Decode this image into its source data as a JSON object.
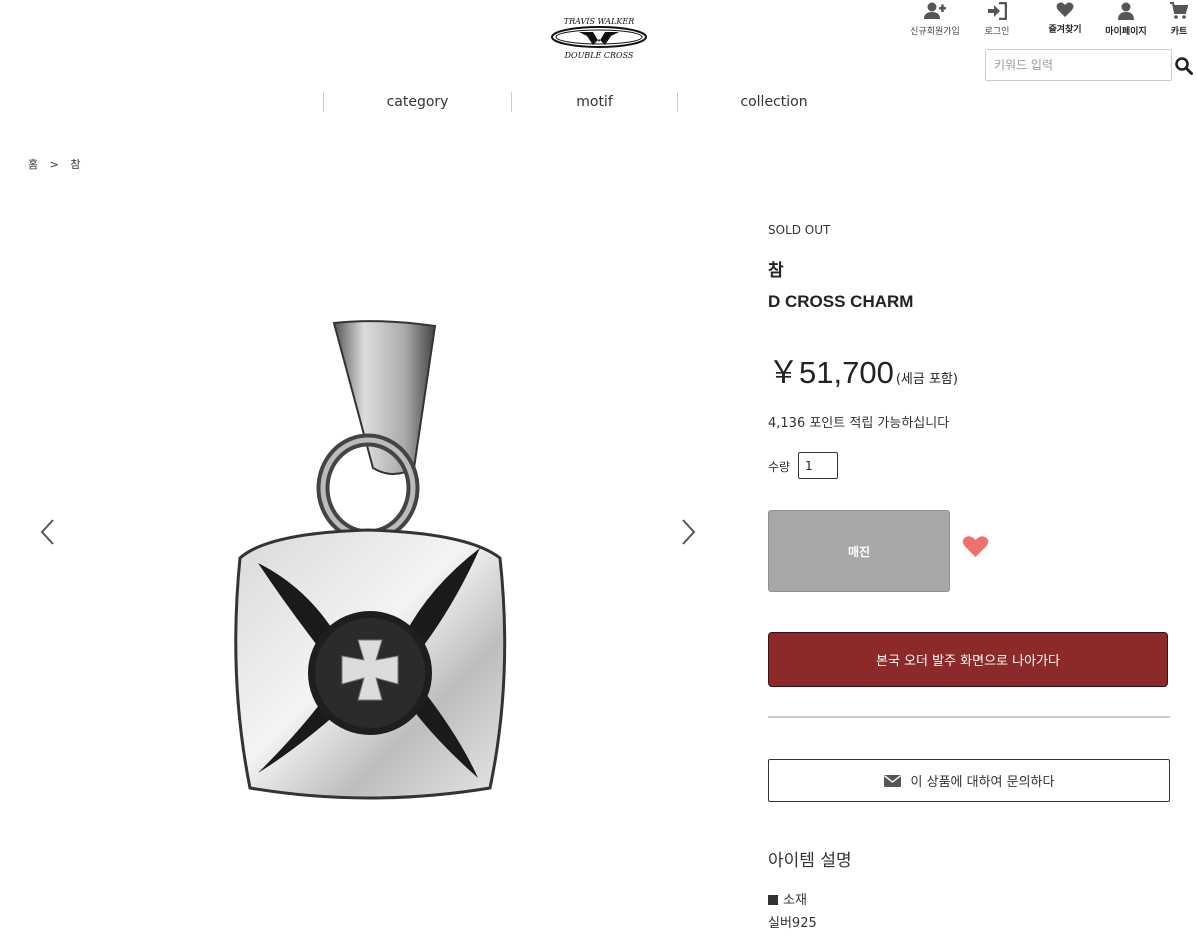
{
  "header": {
    "logo_text_top": "TRAVIS WALKER",
    "logo_text_bottom": "DOUBLE CROSS",
    "util": {
      "signup": "신규회원가입",
      "login": "로그인",
      "favorites": "즐겨찾기",
      "mypage": "마이페이지",
      "cart": "카트"
    },
    "search": {
      "placeholder": "키워드 입력",
      "value": ""
    }
  },
  "nav": {
    "items": [
      "category",
      "motif",
      "collection"
    ]
  },
  "breadcrumb": {
    "home": "홈",
    "sep": ">",
    "current": "참"
  },
  "product": {
    "status": "SOLD OUT",
    "category": "참",
    "name": "D CROSS CHARM",
    "price": "￥51,700",
    "tax_note": "(세금 포함)",
    "points": "4,136 포인트 적립 가능하십니다",
    "qty_label": "수량",
    "qty_value": "1",
    "soldout_label": "매진",
    "order_label": "본국 오더 발주 화면으로 나아가다",
    "inquire_label": "이 상품에 대하여 문의하다",
    "desc_title": "아이템 설명",
    "spec_label": "소재",
    "spec_value": "실버925"
  },
  "colors": {
    "order_button": "#8c2a2a",
    "soldout_button": "#a8a8a8",
    "heart": "#f07070"
  }
}
